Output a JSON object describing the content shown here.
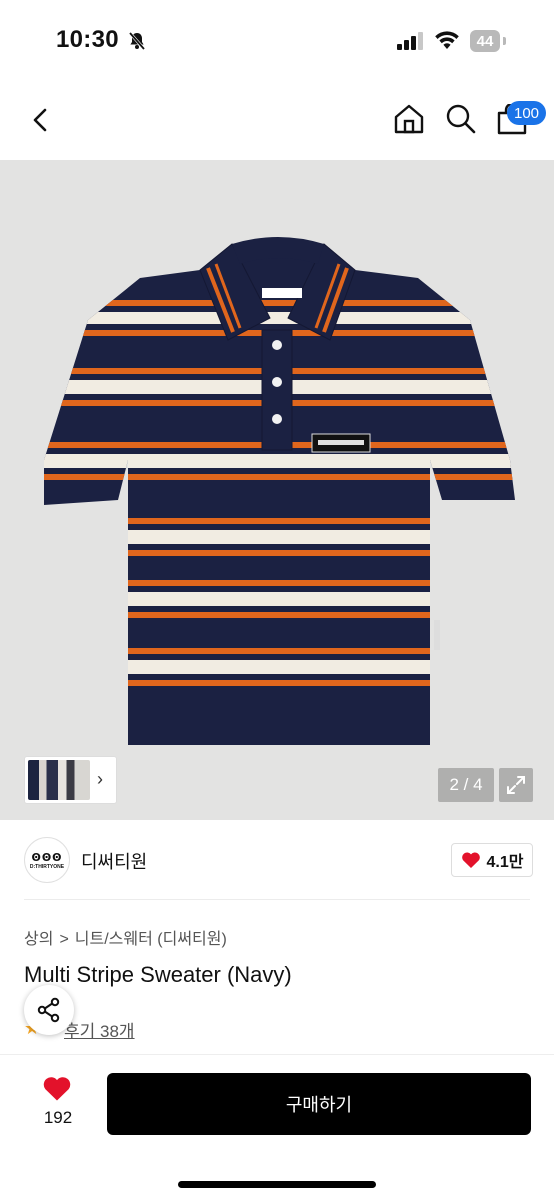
{
  "status_bar": {
    "time": "10:30",
    "battery": "44"
  },
  "nav": {
    "cart_count": "100"
  },
  "gallery": {
    "pager": "2 / 4"
  },
  "brand": {
    "logo_mark": "ꙨꙨꙨ",
    "logo_text": "D:THIRTYONE",
    "name": "디써티원",
    "likes": "4.1만"
  },
  "product": {
    "breadcrumbs": [
      "상의",
      "니트/스웨터 (디써티원)"
    ],
    "breadcrumb_sep": ">",
    "title": "Multi Stripe Sweater (Navy)",
    "rating": "5",
    "review_link": "후기 38개"
  },
  "footer": {
    "wish_count": "192",
    "buy_label": "구매하기"
  },
  "colors": {
    "navy": "#1b2142",
    "orange": "#e0661d",
    "cream": "#f1ece2",
    "badge": "#1a73e8",
    "heart": "#e3122b"
  },
  "icons": {
    "back": "chevron-left-icon",
    "home": "home-icon",
    "search": "search-icon",
    "cart": "shopping-bag-icon",
    "share": "share-icon",
    "heart": "heart-icon",
    "expand": "expand-icon",
    "bell_off": "bell-off-icon",
    "signal": "signal-icon",
    "wifi": "wifi-icon"
  }
}
